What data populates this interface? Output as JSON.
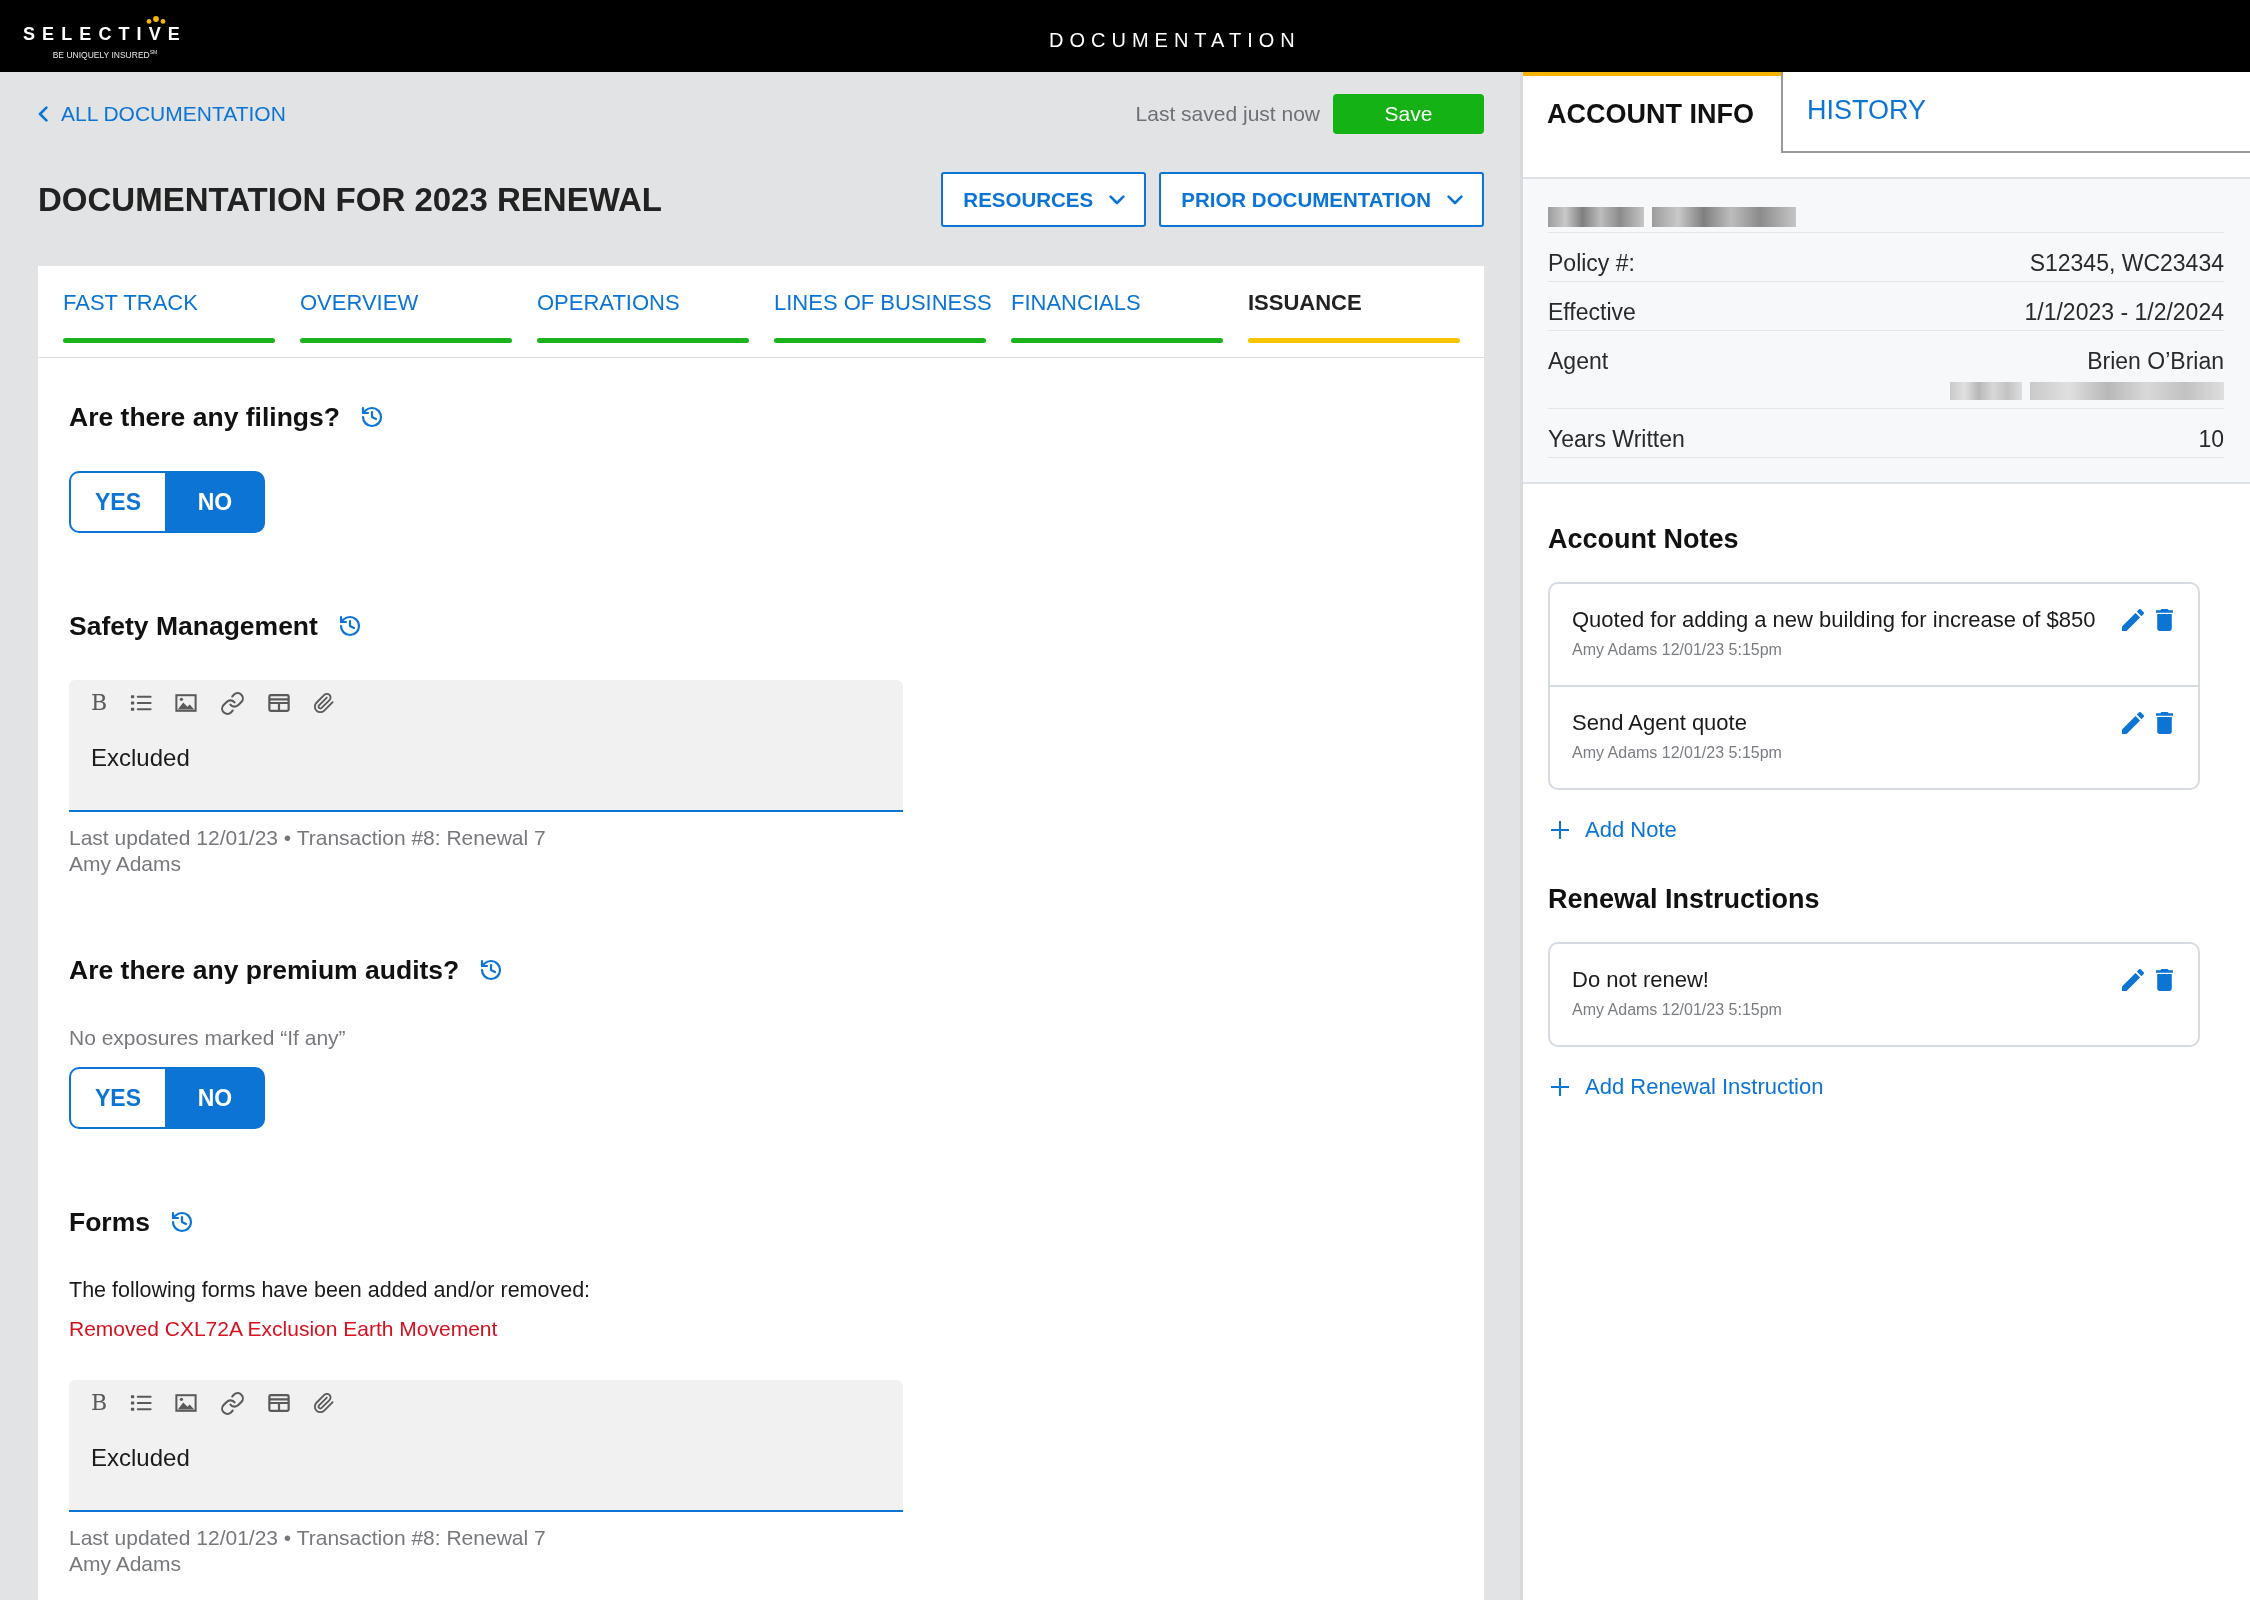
{
  "header": {
    "logo": {
      "wordmark": "SELECTIVE",
      "tagline": "BE UNIQUELY INSURED$^{SM}$"
    },
    "title": "DOCUMENTATION"
  },
  "toolbar": {
    "back_link": "ALL DOCUMENTATION",
    "save_status": "Last saved just now",
    "save_button": "Save"
  },
  "page_title": "DOCUMENTATION FOR 2023 RENEWAL",
  "menus": [
    "RESOURCES",
    "PRIOR DOCUMENTATION"
  ],
  "tabs": [
    {
      "label": "FAST TRACK",
      "selected": false,
      "color": "#1bb31b"
    },
    {
      "label": "OVERVIEW",
      "selected": false,
      "color": "#1bb31b"
    },
    {
      "label": "OPERATIONS",
      "selected": false,
      "color": "#1bb31b"
    },
    {
      "label": "LINES OF BUSINESS",
      "selected": false,
      "color": "#1bb31b"
    },
    {
      "label": "FINANCIALS",
      "selected": false,
      "color": "#1bb31b"
    },
    {
      "label": "ISSUANCE",
      "selected": true,
      "color": "#f7c400"
    }
  ],
  "sections": [
    {
      "kind": "toggle",
      "title": "Are there any filings?",
      "options": [
        {
          "label": "YES",
          "selected": false
        },
        {
          "label": "NO",
          "selected": true
        }
      ]
    },
    {
      "kind": "editor",
      "title": "Safety Management",
      "editor": {
        "bold_tool": "B",
        "value": "Excluded"
      },
      "meta": [
        "Last updated 12/01/23 • Transaction #8: Renewal 7",
        "Amy Adams"
      ]
    },
    {
      "kind": "toggle",
      "title": "Are there any premium audits?",
      "hint": "No exposures marked “If any”",
      "options": [
        {
          "label": "YES",
          "selected": false
        },
        {
          "label": "NO",
          "selected": true
        }
      ]
    },
    {
      "kind": "editor",
      "title": "Forms",
      "intro": "The following forms have been added and/or removed:",
      "changes": [
        {
          "kind": "removed",
          "text": "Removed CXL72A Exclusion Earth Movement"
        }
      ],
      "editor": {
        "bold_tool": "B",
        "value": "Excluded"
      },
      "meta": [
        "Last updated 12/01/23 • Transaction #8: Renewal 7",
        "Amy Adams"
      ]
    }
  ],
  "side_tabs": [
    {
      "label": "ACCOUNT INFO",
      "selected": true
    },
    {
      "label": "HISTORY",
      "selected": false
    }
  ],
  "account": {
    "name_blurred": true,
    "rows": [
      {
        "label": "Policy #:",
        "value": "S12345, WC23434",
        "blurred_line": false
      },
      {
        "label": "Effective",
        "value": "1/1/2023 - 1/2/2024",
        "blurred_line": false
      },
      {
        "label": "Agent",
        "value": "Brien O’Brian",
        "blurred_line": true
      },
      {
        "label": "Years Written",
        "value": "10",
        "blurred_line": false
      }
    ]
  },
  "side_sections": [
    {
      "title": "Account Notes",
      "items": [
        {
          "text": "Quoted for adding a new building for increase of $850",
          "meta": "Amy Adams 12/01/23 5:15pm"
        },
        {
          "text": "Send Agent quote",
          "meta": "Amy Adams 12/01/23 5:15pm"
        }
      ],
      "add_link": "Add Note"
    },
    {
      "title": "Renewal Instructions",
      "items": [
        {
          "text": "Do not renew!",
          "meta": "Amy Adams 12/01/23 5:15pm"
        }
      ],
      "add_link": "Add Renewal Instruction"
    }
  ]
}
